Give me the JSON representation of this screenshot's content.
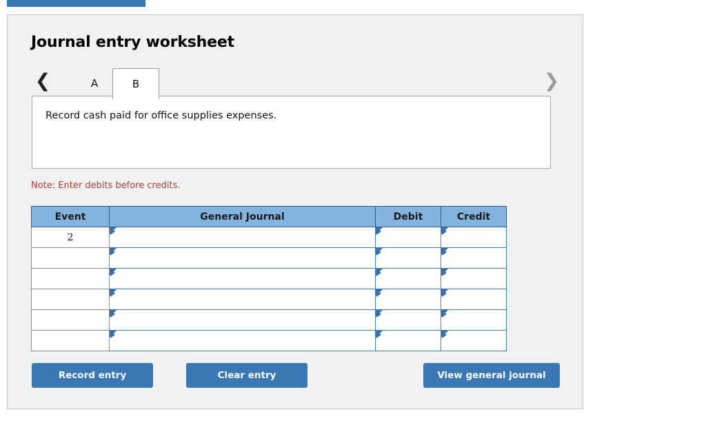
{
  "top_tab": {
    "label": ""
  },
  "panel": {
    "title": "Journal entry worksheet",
    "tabs": {
      "prev_icon": "chevron-left-icon",
      "next_icon": "chevron-right-icon",
      "items": [
        {
          "label": "A",
          "active": false
        },
        {
          "label": "B",
          "active": true
        }
      ]
    },
    "description": "Record cash paid for office supplies expenses.",
    "note": "Note: Enter debits before credits.",
    "table": {
      "columns": [
        "Event",
        "General Journal",
        "Debit",
        "Credit"
      ],
      "rows": [
        {
          "event": "2",
          "general_journal": "",
          "debit": "",
          "credit": ""
        },
        {
          "event": "",
          "general_journal": "",
          "debit": "",
          "credit": ""
        },
        {
          "event": "",
          "general_journal": "",
          "debit": "",
          "credit": ""
        },
        {
          "event": "",
          "general_journal": "",
          "debit": "",
          "credit": ""
        },
        {
          "event": "",
          "general_journal": "",
          "debit": "",
          "credit": ""
        },
        {
          "event": "",
          "general_journal": "",
          "debit": "",
          "credit": ""
        }
      ]
    },
    "buttons": {
      "record": "Record entry",
      "clear": "Clear entry",
      "view": "View general journal"
    }
  },
  "colors": {
    "button_blue": "#3A78B5",
    "header_blue": "#85B3E0",
    "cell_border_blue": "#3E7CB5",
    "note_red": "#B03A35",
    "panel_bg": "#F1F1F1"
  }
}
